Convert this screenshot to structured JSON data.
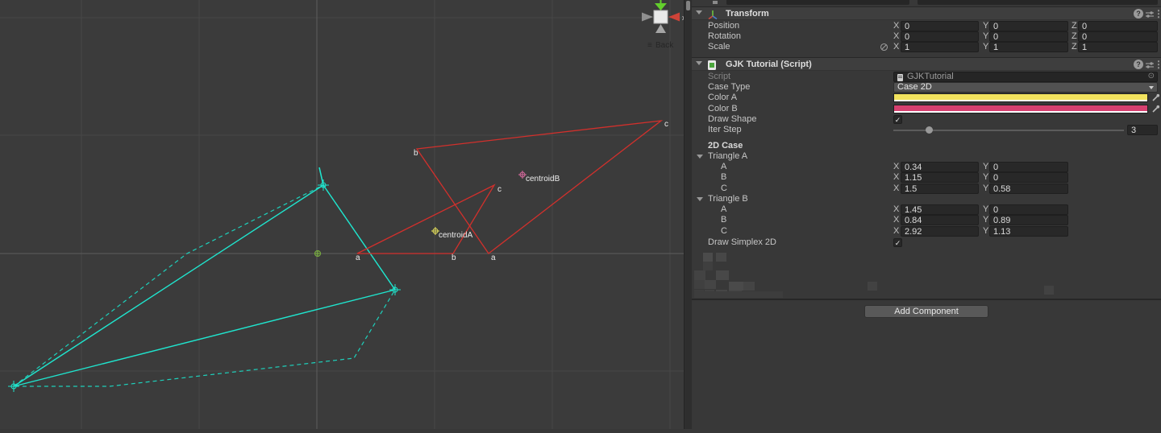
{
  "icons": {
    "checkmark": "✓",
    "kebab": "⋮",
    "help": "?",
    "object_picker": "⊙",
    "back_menu": "≡"
  },
  "scene": {
    "gizmo": {
      "axis_label": "x",
      "view_label": "Back"
    },
    "triangle_a_labels": {
      "a": "a",
      "b": "b",
      "c": "c"
    },
    "triangle_b_labels": {
      "a": "a",
      "b": "b",
      "c": "c"
    },
    "centroid_a_label": "centroidA",
    "centroid_b_label": "centroidB",
    "colors": {
      "shape": "#d2302c",
      "simplex": "#1fe5ce",
      "centroid_a": "#e6e05a",
      "centroid_b": "#d86a9e"
    }
  },
  "inspector": {
    "transform": {
      "title": "Transform",
      "axis_x": "X",
      "axis_y": "Y",
      "axis_z": "Z",
      "rows": [
        {
          "label": "Position",
          "x": "0",
          "y": "0",
          "z": "0"
        },
        {
          "label": "Rotation",
          "x": "0",
          "y": "0",
          "z": "0"
        },
        {
          "label": "Scale",
          "x": "1",
          "y": "1",
          "z": "1"
        }
      ]
    },
    "gjk": {
      "title": "GJK Tutorial (Script)",
      "script_label": "Script",
      "script_value": "GJKTutorial",
      "case_type_label": "Case Type",
      "case_type_value": "Case 2D",
      "color_a_label": "Color A",
      "color_a_value": "#f2e35e",
      "color_b_label": "Color B",
      "color_b_value": "#d6406f",
      "draw_shape_label": "Draw Shape",
      "iter_step_label": "Iter Step",
      "iter_step_value": "3",
      "section_label": "2D Case",
      "triangle_a": {
        "title": "Triangle A",
        "rows": [
          {
            "label": "A",
            "x": "0.34",
            "y": "0"
          },
          {
            "label": "B",
            "x": "1.15",
            "y": "0"
          },
          {
            "label": "C",
            "x": "1.5",
            "y": "0.58"
          }
        ]
      },
      "triangle_b": {
        "title": "Triangle B",
        "rows": [
          {
            "label": "A",
            "x": "1.45",
            "y": "0"
          },
          {
            "label": "B",
            "x": "0.84",
            "y": "0.89"
          },
          {
            "label": "C",
            "x": "2.92",
            "y": "1.13"
          }
        ]
      },
      "draw_simplex_label": "Draw Simplex 2D"
    },
    "add_component_label": "Add Component"
  }
}
